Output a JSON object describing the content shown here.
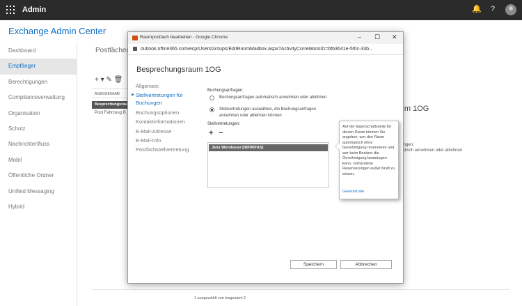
{
  "topbar": {
    "app_name": "Admin",
    "bell_glyph": "🔔",
    "help_glyph": "?"
  },
  "eac": {
    "title": "Exchange Admin Center",
    "nav": [
      "Dashboard",
      "Empfänger",
      "Berechtigungen",
      "Complianceverwaltung",
      "Organisation",
      "Schutz",
      "Nachrichtenfluss",
      "Mobil",
      "Öffentliche Ordner",
      "Unified Messaging",
      "Hybrid"
    ],
    "active_nav": "Empfänger",
    "heading": "Postfächer",
    "toolbar": "+ ▾ ✎ 🗑",
    "table_header": "ANZEIGENAME",
    "rows": [
      "Besprechungsraum 1OG",
      "Pool Fahrzeug B"
    ],
    "detail_title": "raum 1OG",
    "detail_lines": [
      "chungen:",
      "omatisch annehmen oder ablehnen"
    ],
    "footer": "1 ausgewählt von insgesamt 2"
  },
  "popup": {
    "window_title": "Raumpostfach bearbeiten - Google Chrome",
    "minimize": "–",
    "maximize": "☐",
    "close": "✕",
    "url": "outlook.office365.com/ecp/UsersGroups/EditRoomMailbox.aspx?ActivityCorrelationID=6fb3641e-5f0c-33b...",
    "dialog_title": "Besprechungsraum 1OG",
    "nav": {
      "allgemein": "Allgemein",
      "stellvertretungen": "Stellvertretungen für Buchungen",
      "buchungsoptionen": "Buchungsoptionen",
      "kontakt": "Kontaktinformationen",
      "email_adresse": "E-Mail-Adresse",
      "email_info": "E-Mail-Info",
      "postfach": "Postfachstellvertretung"
    },
    "booking_label": "Buchungsanfragen:",
    "option_auto": "Buchungsanfragen automatisch annehmen oder ablehnen",
    "option_delegate": "Stellvertretungen auswählen, die Buchungsanfragen annehmen oder ablehnen können",
    "delegates_label": "Stellvertretungen:",
    "add_glyph": "+",
    "remove_glyph": "−",
    "delegates": [
      "Jens Wernheuer [INFINITAS]"
    ],
    "callout_text": "Auf der Eigenschaftsseite für diesen Raum können Sie angeben, wer den Raum automatisch ohne Genehmigung reservieren und wer beim Besitzer die Genehmigung beantragen kann, vorhandene Reservierungen außer Kraft zu setzen.",
    "callout_link": "Gewusst wie",
    "save": "Speichern",
    "cancel": "Abbrechen"
  }
}
